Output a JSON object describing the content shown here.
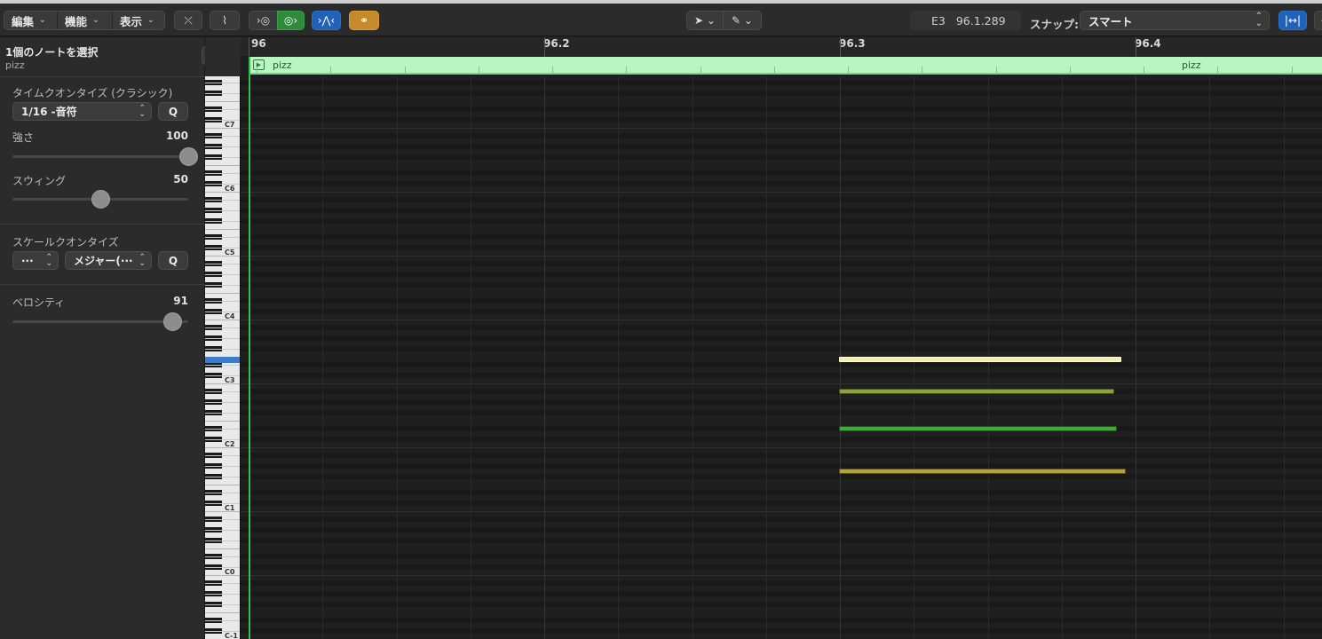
{
  "toolbar": {
    "menus": [
      "編集",
      "機能",
      "表示"
    ],
    "position_note": "E3",
    "position_value": "96.1.289",
    "snap_label": "スナップ:",
    "snap_value": "スマート"
  },
  "inspector": {
    "selection_title": "1個のノートを選択",
    "region_name": "pizz",
    "time_quantize": {
      "header": "タイムクオンタイズ (クラシック)",
      "value": "1/16 -音符",
      "q_label": "Q",
      "strength_label": "強さ",
      "strength_value": "100",
      "strength_level": 100,
      "swing_label": "スウィング",
      "swing_value": "50",
      "swing_level": 50
    },
    "scale_quantize": {
      "header": "スケールクオンタイズ",
      "root_value": "···",
      "scale_value": "メジャー(···",
      "q_label": "Q"
    },
    "velocity": {
      "label": "ベロシティ",
      "value": "91",
      "level": 91
    }
  },
  "ruler": {
    "labels": [
      "96",
      "96.2",
      "96.3",
      "96.4"
    ]
  },
  "region": {
    "name": "pizz",
    "name_repeat": "pizz",
    "color": "#b9f5c1"
  },
  "keyboard": {
    "octave_labels": [
      "C7",
      "C6",
      "C5",
      "C4",
      "C3",
      "C2",
      "C1",
      "C0",
      "C-1"
    ],
    "highlight_key": "E3"
  },
  "notes": [
    {
      "pitch": "E3",
      "selected": true,
      "color": "#f3ecaa"
    },
    {
      "pitch": "A#2",
      "selected": false,
      "color": "#8aa33c"
    },
    {
      "pitch": "D#2",
      "selected": false,
      "color": "#3fa83a"
    },
    {
      "pitch": "G1",
      "selected": false,
      "color": "#b4a33c"
    }
  ]
}
